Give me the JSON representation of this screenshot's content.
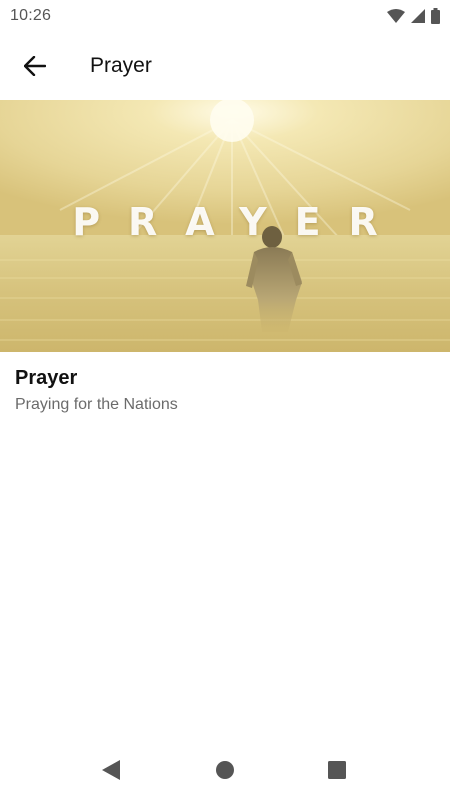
{
  "status_bar": {
    "time": "10:26",
    "icons": [
      "wifi-icon",
      "cell-signal-icon",
      "battery-icon"
    ]
  },
  "app_bar": {
    "back_icon": "arrow-left-icon",
    "title": "Prayer"
  },
  "hero": {
    "overlay_text": "PRAYER",
    "palette": {
      "sky": "#e9dca0",
      "sun": "#fff8d8",
      "water": "#d8c688"
    }
  },
  "item": {
    "title": "Prayer",
    "subtitle": "Praying for the Nations"
  },
  "nav_bar": {
    "icons": [
      "back-triangle-icon",
      "home-circle-icon",
      "recents-square-icon"
    ]
  }
}
